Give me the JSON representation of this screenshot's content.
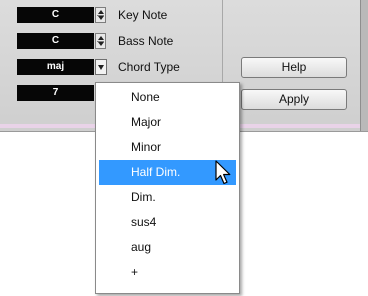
{
  "fields": {
    "key_note": {
      "value": "C",
      "label": "Key Note"
    },
    "bass_note": {
      "value": "C",
      "label": "Bass Note"
    },
    "chord_type": {
      "value": "maj",
      "label": "Chord Type"
    },
    "fourth": {
      "value": "7"
    }
  },
  "buttons": {
    "help": "Help",
    "apply": "Apply"
  },
  "menu": {
    "items": [
      "None",
      "Major",
      "Minor",
      "Half Dim.",
      "Dim.",
      "sus4",
      "aug",
      "+"
    ],
    "selected": "Half Dim."
  },
  "colors": {
    "highlight": "#3399ff",
    "lcd_bg": "#060606",
    "lcd_text": "#ffffff"
  }
}
